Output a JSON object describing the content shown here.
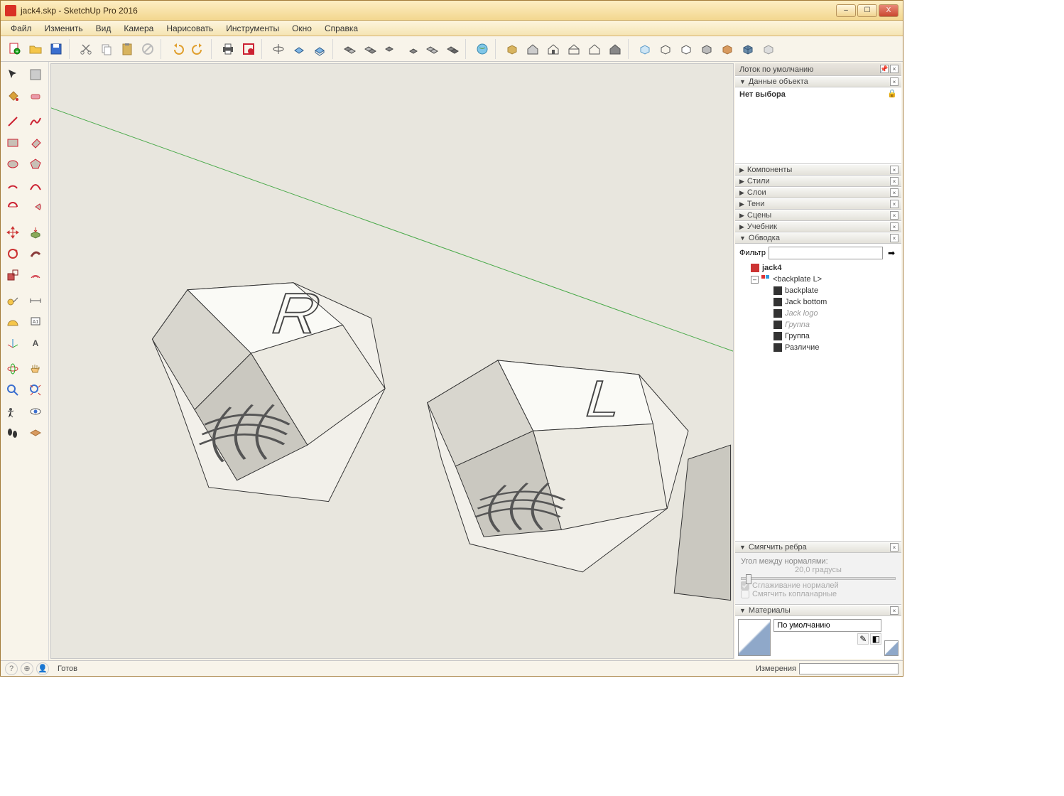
{
  "window": {
    "title": "jack4.skp - SketchUp Pro 2016",
    "min": "–",
    "max": "☐",
    "close": "X"
  },
  "menu": [
    "Файл",
    "Изменить",
    "Вид",
    "Камера",
    "Нарисовать",
    "Инструменты",
    "Окно",
    "Справка"
  ],
  "tray": {
    "title": "Лоток по умолчанию",
    "entity_info": {
      "header": "Данные объекта",
      "status": "Нет выбора"
    },
    "components": "Компоненты",
    "styles": "Стили",
    "layers": "Слои",
    "shadows": "Тени",
    "scenes": "Сцены",
    "instructor": "Учебник",
    "outliner": {
      "header": "Обводка",
      "filter_label": "Фильтр",
      "root": "jack4",
      "items": [
        {
          "label": "<backplate L>",
          "type": "comp",
          "expandable": true,
          "indent": 1
        },
        {
          "label": "backplate",
          "type": "cube",
          "indent": 2
        },
        {
          "label": "Jack bottom",
          "type": "cube",
          "indent": 2
        },
        {
          "label": "Jack logo",
          "type": "cube",
          "indent": 2,
          "italic": true
        },
        {
          "label": "Группа",
          "type": "cube",
          "indent": 2,
          "italic": true
        },
        {
          "label": "Группа",
          "type": "cube",
          "indent": 2
        },
        {
          "label": "Различие",
          "type": "cube",
          "indent": 2
        }
      ]
    },
    "soften": {
      "header": "Смягчить ребра",
      "angle_label": "Угол между нормалями:",
      "angle_value": "20,0  градусы",
      "smooth_normals": "Сглаживание нормалей",
      "soften_coplanar": "Смягчить копланарные"
    },
    "materials": {
      "header": "Материалы",
      "name": "По умолчанию"
    }
  },
  "status": {
    "text": "Готов",
    "measurements": "Измерения"
  }
}
